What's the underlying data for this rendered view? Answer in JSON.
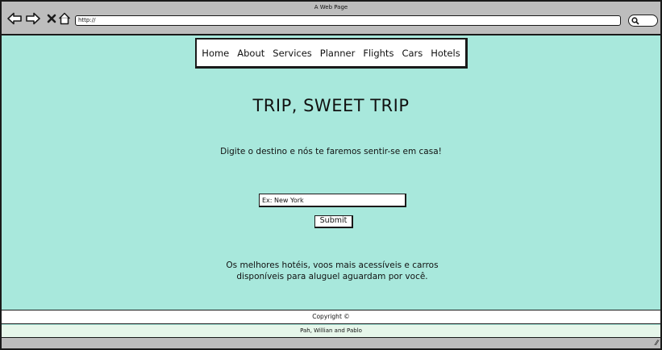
{
  "window": {
    "title": "A Web Page",
    "url": "http://"
  },
  "toolbar": {
    "icons": [
      "back-arrow-icon",
      "forward-arrow-icon",
      "close-x-icon",
      "home-icon",
      "search-icon"
    ]
  },
  "menu": {
    "items": [
      "Home",
      "About",
      "Services",
      "Planner",
      "Flights",
      "Cars",
      "Hotels"
    ]
  },
  "hero": {
    "title": "TRIP, SWEET TRIP",
    "subtitle": "Digite o destino e nós te faremos sentir-se em casa!"
  },
  "search": {
    "placeholder": "Ex: New York",
    "value": "",
    "submit_label": "Submit"
  },
  "promo": {
    "line1": "Os melhores hotéis, voos mais acessíveis e carros",
    "line2": "disponíveis para aluguel aguardam por você."
  },
  "footer": {
    "copyright": "Copyright ©",
    "credits": "Pah, Willian and Pablo"
  },
  "colors": {
    "page_background": "#a8e8dc",
    "chrome": "#bdbdbd",
    "credits_bar": "#e6f6ea",
    "border": "#1a1a1a"
  }
}
